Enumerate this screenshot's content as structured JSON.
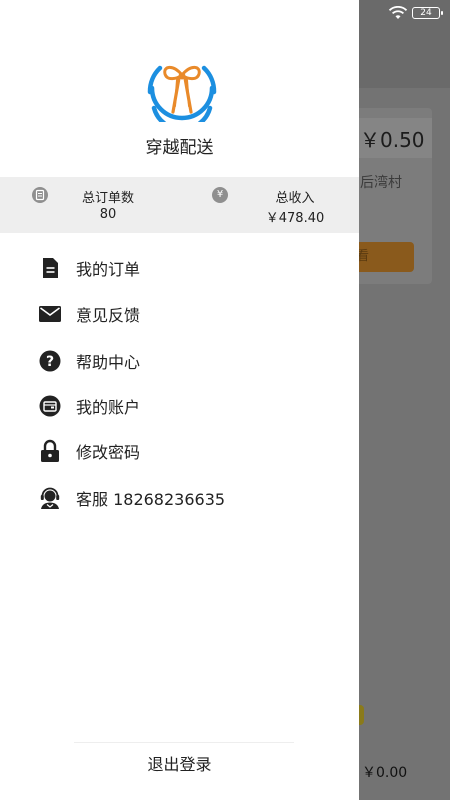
{
  "status_bar": {
    "wifi_icon": "wifi-icon",
    "battery_level": "24"
  },
  "background": {
    "price": "￥0.50",
    "place": "后湾村",
    "button": "看",
    "bottom_price": "￥0.00"
  },
  "drawer": {
    "logo_icon": "bow-ribbon-logo",
    "app_name": "穿越配送",
    "colors": {
      "logo_blue": "#1c8fe0",
      "logo_orange": "#e98a2a",
      "stats_bg": "#eeeeee"
    },
    "stats": [
      {
        "icon": "document-icon",
        "label": "总订单数",
        "value": "80"
      },
      {
        "icon": "yen-icon",
        "icon_glyph": "¥",
        "label": "总收入",
        "value": "￥478.40"
      }
    ],
    "menu": [
      {
        "icon": "order-list-icon",
        "label": "我的订单"
      },
      {
        "icon": "mail-icon",
        "label": "意见反馈"
      },
      {
        "icon": "help-icon",
        "label": "帮助中心"
      },
      {
        "icon": "wallet-icon",
        "label": "我的账户"
      },
      {
        "icon": "lock-icon",
        "label": "修改密码"
      },
      {
        "icon": "customer-service-icon",
        "label": "客服 18268236635"
      }
    ],
    "logout_label": "退出登录"
  }
}
